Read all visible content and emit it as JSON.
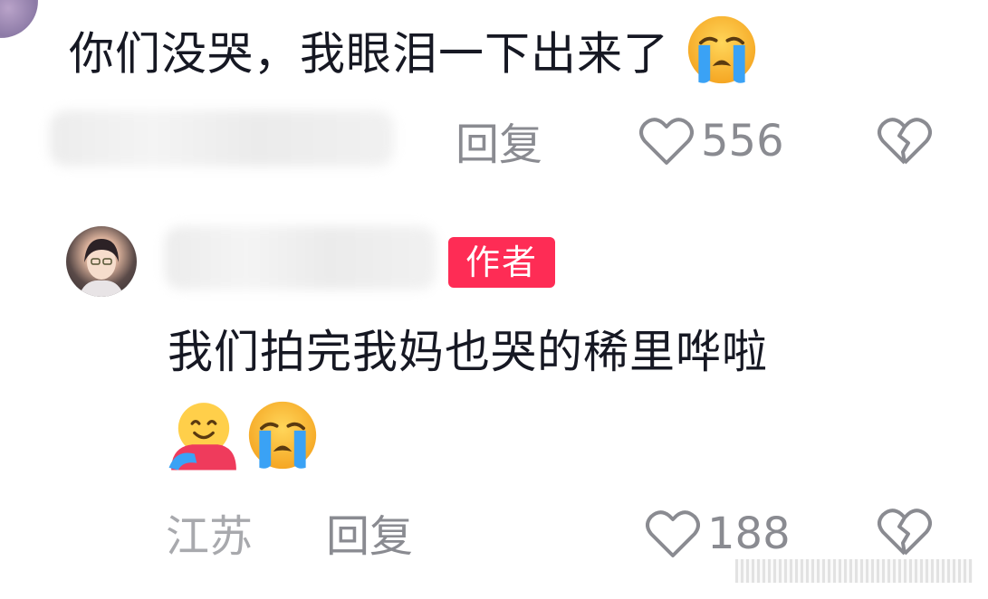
{
  "comments": [
    {
      "text": "你们没哭，我眼泪一下出来了",
      "emojis": [
        "loudly-crying-face"
      ],
      "reply_label": "回复",
      "location": "",
      "likes": "556",
      "author_tag": ""
    },
    {
      "text": "我们拍完我妈也哭的稀里哗啦",
      "emojis": [
        "hugging-face",
        "loudly-crying-face"
      ],
      "reply_label": "回复",
      "location": "江苏",
      "likes": "188",
      "author_tag": "作者"
    }
  ],
  "colors": {
    "badge": "#fe2c55",
    "meta_text": "#8a8b91",
    "main_text": "#161823"
  }
}
